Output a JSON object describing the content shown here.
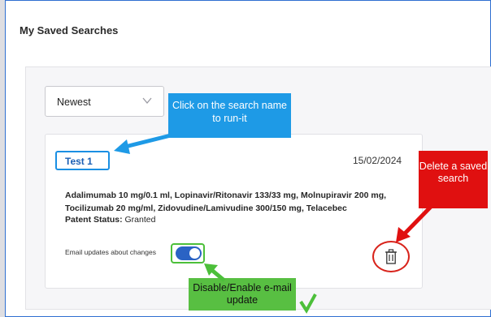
{
  "page": {
    "title": "My Saved Searches"
  },
  "sort": {
    "selected": "Newest"
  },
  "saved_search": {
    "name": "Test 1",
    "date": "15/02/2024",
    "terms_line1": "Adalimumab 10 mg/0.1 ml, Lopinavir/Ritonavir 133/33 mg, Molnupiravir 200 mg,",
    "terms_line2": "Tocilizumab 20 mg/ml, Zidovudine/Lamivudine 300/150 mg, Telacebec",
    "patent_status_label": "Patent Status:",
    "patent_status_value": "Granted",
    "email_updates_label": "Email updates about changes",
    "email_updates_enabled": true
  },
  "annotations": {
    "run_tip": "Click on the search name to run-it",
    "delete_tip": "Delete a saved search",
    "toggle_tip": "Disable/Enable e-mail update"
  },
  "colors": {
    "frame_border": "#2f6fd1",
    "highlight_blue": "#1a8fe3",
    "highlight_red": "#d8231b",
    "highlight_green": "#4cbf3a",
    "toggle_on": "#2a63c4"
  },
  "icons": {
    "sort_chevron": "chevron-down-icon",
    "delete": "trash-icon"
  }
}
